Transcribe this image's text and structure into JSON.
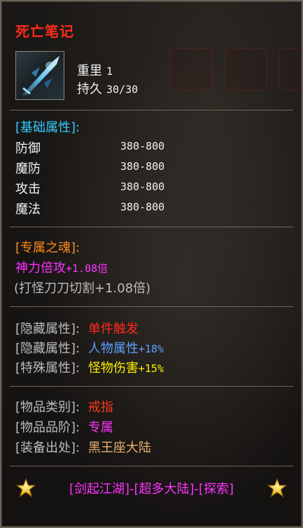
{
  "item": {
    "name": "死亡笔记",
    "weight_label": "重里",
    "weight_value": "1",
    "durability_label": "持久",
    "durability_value": "30/30"
  },
  "basic": {
    "header": "[基础属性]:",
    "rows": [
      {
        "label": "防御",
        "value": "380-800"
      },
      {
        "label": "魔防",
        "value": "380-800"
      },
      {
        "label": "攻击",
        "value": "380-800"
      },
      {
        "label": "魔法",
        "value": "380-800"
      }
    ]
  },
  "soul": {
    "header": "[专属之魂]:",
    "line1_name": "神力倍攻",
    "line1_value": "+1.08倍",
    "line2": "(打怪刀刀切割+1.08倍)"
  },
  "hidden": {
    "rows": [
      {
        "label": "[隐藏属性]:",
        "name": "单件触发",
        "value": "",
        "color": "#ff2a1a"
      },
      {
        "label": "[隐藏属性]:",
        "name": "人物属性",
        "value": "+18%",
        "color": "#5aa0ff"
      },
      {
        "label": "[特殊属性]:",
        "name": "怪物伤害",
        "value": "+15%",
        "color": "#ffee00"
      }
    ]
  },
  "info": {
    "rows": [
      {
        "label": "[物品类别]:",
        "value": "戒指",
        "color": "#ff3a1a"
      },
      {
        "label": "[物品品阶]:",
        "value": "专属",
        "color": "#ff33ff"
      },
      {
        "label": "[装备出处]:",
        "value": "黑王座大陆",
        "color": "#e8b070"
      }
    ]
  },
  "footer": {
    "text": "[剑起江湖]-[超多大陆]-[探索]",
    "star_icon": "star-icon"
  },
  "colors": {
    "title": "#ff2a1a",
    "cyan_header": "#33ccff",
    "orange_header": "#ff8a1a",
    "magenta": "#ff33ff"
  }
}
